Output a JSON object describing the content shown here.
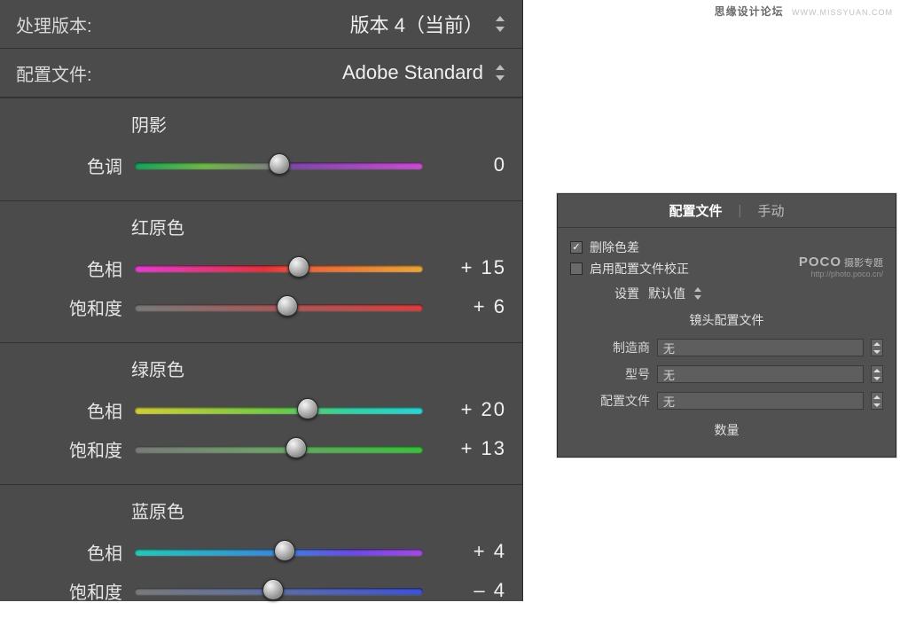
{
  "watermark_top": {
    "brand": "思缘设计论坛",
    "url": "WWW.MISSYUAN.COM"
  },
  "watermark_poco": {
    "logo": "POCO",
    "tag": "摄影专题",
    "url": "http://photo.poco.cn/"
  },
  "left_panel": {
    "process_version": {
      "label": "处理版本:",
      "value": "版本 4（当前）"
    },
    "profile": {
      "label": "配置文件:",
      "value": "Adobe Standard"
    },
    "groups": [
      {
        "title": "阴影",
        "sliders": [
          {
            "label": "色调",
            "value": "0",
            "grad": "grad-shadow",
            "pos": 50
          }
        ]
      },
      {
        "title": "红原色",
        "sliders": [
          {
            "label": "色相",
            "value": "+ 15",
            "grad": "grad-red-hue",
            "pos": 57
          },
          {
            "label": "饱和度",
            "value": "+ 6",
            "grad": "grad-red-sat",
            "pos": 53
          }
        ]
      },
      {
        "title": "绿原色",
        "sliders": [
          {
            "label": "色相",
            "value": "+ 20",
            "grad": "grad-green-hue",
            "pos": 60
          },
          {
            "label": "饱和度",
            "value": "+ 13",
            "grad": "grad-green-sat",
            "pos": 56
          }
        ]
      },
      {
        "title": "蓝原色",
        "sliders": [
          {
            "label": "色相",
            "value": "+ 4",
            "grad": "grad-blue-hue",
            "pos": 52
          },
          {
            "label": "饱和度",
            "value": "– 4",
            "grad": "grad-blue-sat",
            "pos": 48
          }
        ]
      }
    ]
  },
  "right_panel": {
    "tabs": {
      "active": "配置文件",
      "inactive": "手动"
    },
    "chk_remove_ca": {
      "label": "删除色差",
      "checked": true
    },
    "chk_enable_lens": {
      "label": "启用配置文件校正",
      "checked": false
    },
    "settings_row": {
      "label": "设置",
      "value": "默认值"
    },
    "lens_section_title": "镜头配置文件",
    "fields": {
      "maker": {
        "label": "制造商",
        "value": "无"
      },
      "model": {
        "label": "型号",
        "value": "无"
      },
      "profile": {
        "label": "配置文件",
        "value": "无"
      }
    },
    "amount_title": "数量"
  }
}
